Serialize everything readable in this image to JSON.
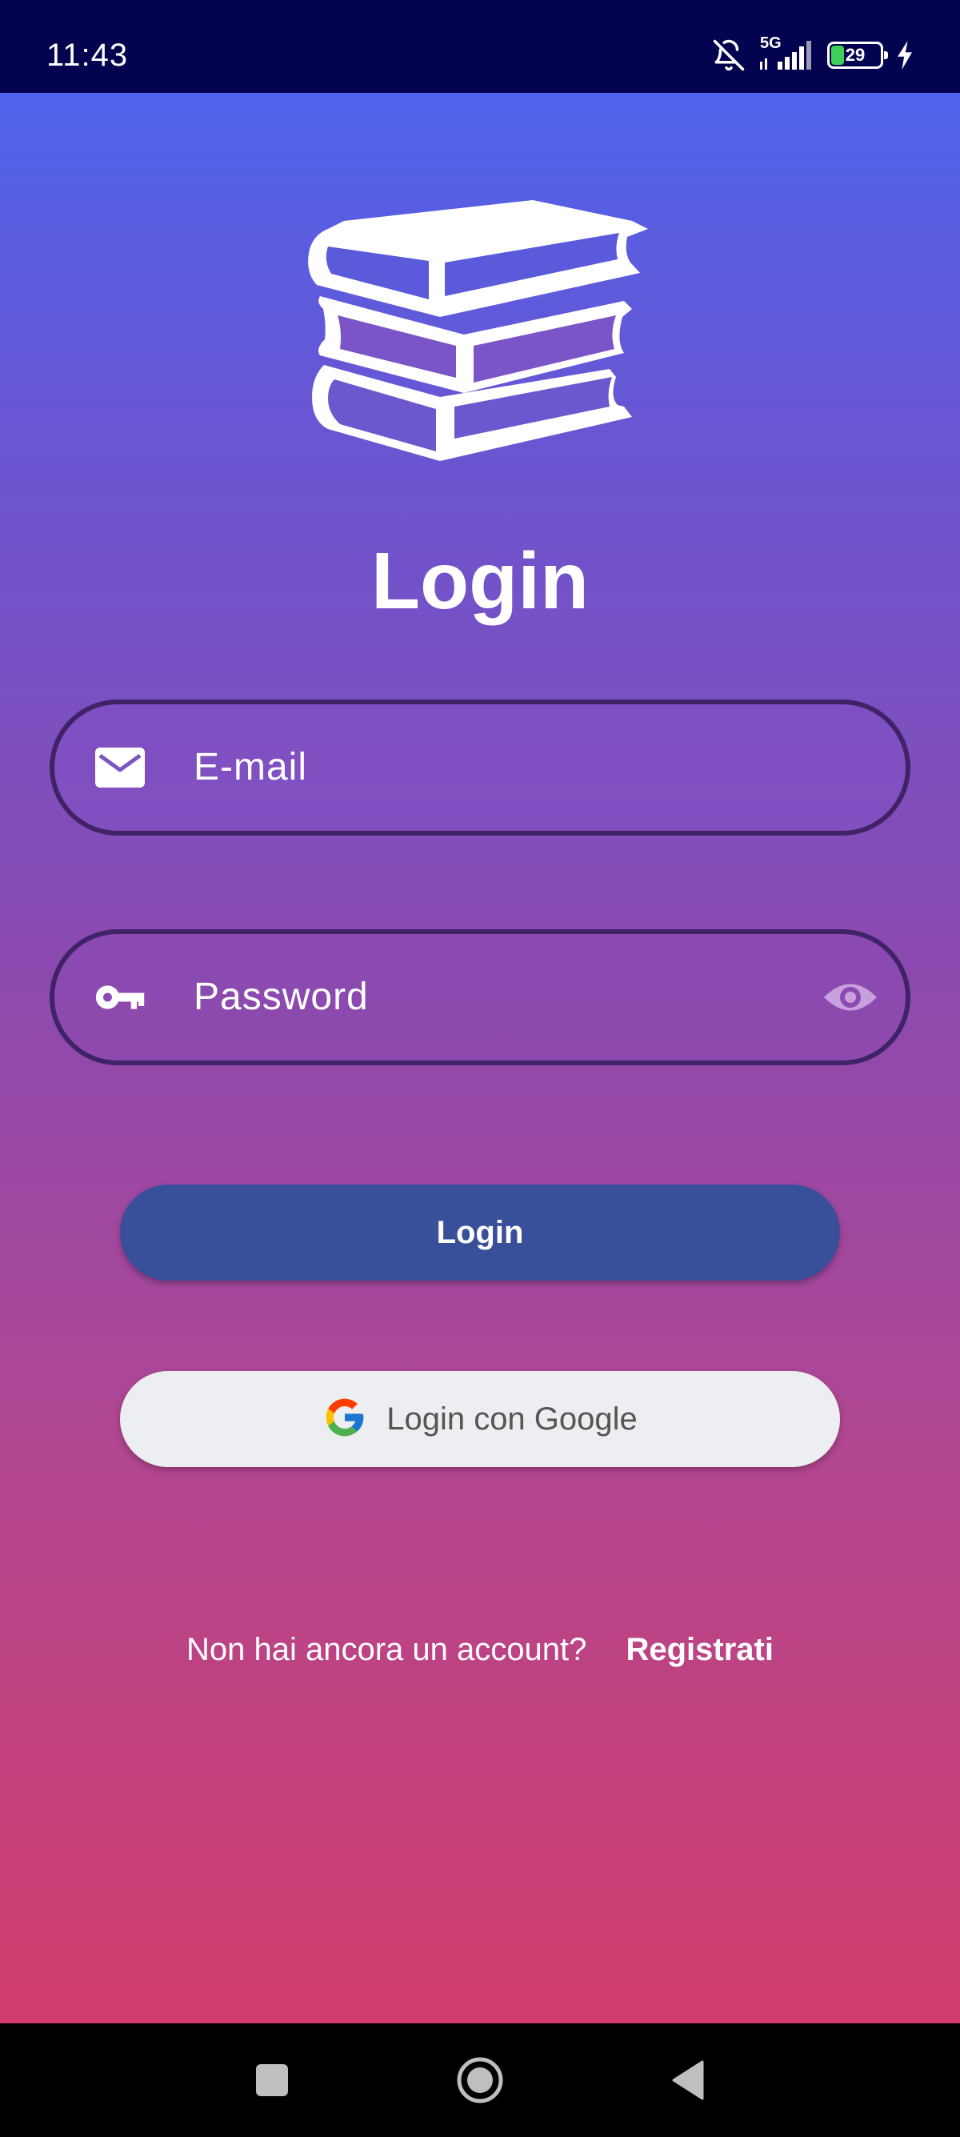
{
  "status_bar": {
    "time": "11:43",
    "network": "5G",
    "battery_level": "29",
    "icons": [
      "bell-off-icon",
      "signal-5g-icon",
      "battery-icon",
      "charging-icon"
    ]
  },
  "login": {
    "title": "Login",
    "logo_icon": "books-stack-icon",
    "email": {
      "placeholder": "E-mail",
      "icon": "mail-icon"
    },
    "password": {
      "placeholder": "Password",
      "icon": "key-icon",
      "toggle_icon": "eye-icon"
    },
    "login_button_label": "Login",
    "google_button_label": "Login con Google",
    "signup_question": "Non hai ancora un account?",
    "signup_link": "Registrati"
  },
  "nav_bar": {
    "icons": [
      "recent-apps-icon",
      "home-icon",
      "back-icon"
    ]
  },
  "colors": {
    "status_bar": "#03034f",
    "gradient_top": "#4e63ea",
    "gradient_bottom": "#d13d6c",
    "field_border": "#3f2366",
    "login_button": "#3a4f9a",
    "google_button": "#eceef1"
  }
}
